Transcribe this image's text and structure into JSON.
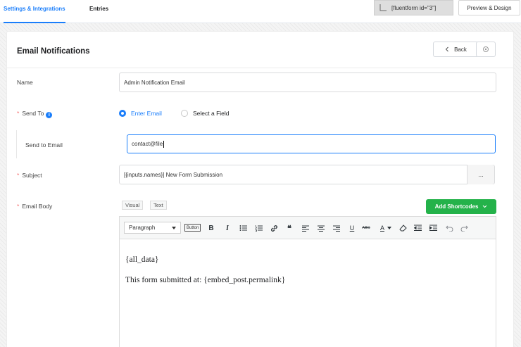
{
  "tabs": [
    {
      "label": "Settings & Integrations",
      "active": true
    },
    {
      "label": "Entries",
      "active": false
    }
  ],
  "shortcode": "[fluentform id=\"3\"]",
  "preview_button": "Preview & Design",
  "card": {
    "title": "Email Notifications",
    "back_label": "Back"
  },
  "form": {
    "name_label": "Name",
    "name_value": "Admin Notification Email",
    "send_to_label": "Send To",
    "send_to_options": [
      {
        "label": "Enter Email",
        "selected": true
      },
      {
        "label": "Select a Field",
        "selected": false
      }
    ],
    "send_to_email_label": "Send to Email",
    "send_to_email_value": "contact@file",
    "subject_label": "Subject",
    "subject_value": "[{inputs.names}] New Form Submission",
    "subject_more": "...",
    "body_label": "Email Body",
    "mode_tabs": [
      "Visual",
      "Text"
    ],
    "add_shortcodes": "Add Shortcodes"
  },
  "editor": {
    "format_select": "Paragraph",
    "button_tag": "Button",
    "toolbar_glyphs": {
      "bold": "B",
      "italic": "I",
      "blockquote": "❝",
      "underline": "U",
      "strike": "ABC",
      "textcolor": "A"
    },
    "lines": [
      "{all_data}",
      "This form submitted at: {embed_post.permalink}"
    ]
  },
  "colors": {
    "accent": "#1a7efb",
    "success": "#24b24a",
    "required": "#f56c6c"
  }
}
